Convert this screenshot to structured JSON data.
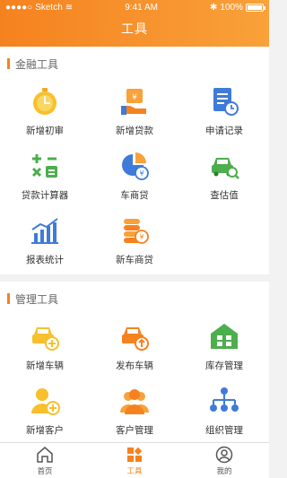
{
  "status": {
    "carrier": "Sketch",
    "time": "9:41 AM",
    "battery": "100%"
  },
  "header": {
    "title": "工具"
  },
  "sections": [
    {
      "title": "金融工具",
      "items": [
        {
          "label": "新增初审",
          "icon": "stopwatch-icon"
        },
        {
          "label": "新增贷款",
          "icon": "money-hand-icon"
        },
        {
          "label": "申请记录",
          "icon": "document-clock-icon"
        },
        {
          "label": "贷款计算器",
          "icon": "calculator-icon"
        },
        {
          "label": "车商贷",
          "icon": "pie-yen-icon"
        },
        {
          "label": "查估值",
          "icon": "car-search-icon"
        },
        {
          "label": "报表统计",
          "icon": "bar-chart-icon"
        },
        {
          "label": "新车商贷",
          "icon": "coin-stack-icon"
        }
      ]
    },
    {
      "title": "管理工具",
      "items": [
        {
          "label": "新增车辆",
          "icon": "car-add-icon"
        },
        {
          "label": "发布车辆",
          "icon": "car-publish-icon"
        },
        {
          "label": "库存管理",
          "icon": "warehouse-icon"
        },
        {
          "label": "新增客户",
          "icon": "user-add-icon"
        },
        {
          "label": "客户管理",
          "icon": "users-icon"
        },
        {
          "label": "组织管理",
          "icon": "org-chart-icon"
        }
      ]
    }
  ],
  "tabbar": [
    {
      "label": "首页",
      "icon": "home-icon",
      "active": false
    },
    {
      "label": "工具",
      "icon": "tools-grid-icon",
      "active": true
    },
    {
      "label": "我的",
      "icon": "profile-icon",
      "active": false
    }
  ],
  "colors": {
    "accent": "#f5821f",
    "blue": "#3f7bd8",
    "green": "#4cae4c",
    "yellow": "#f7c02c"
  }
}
